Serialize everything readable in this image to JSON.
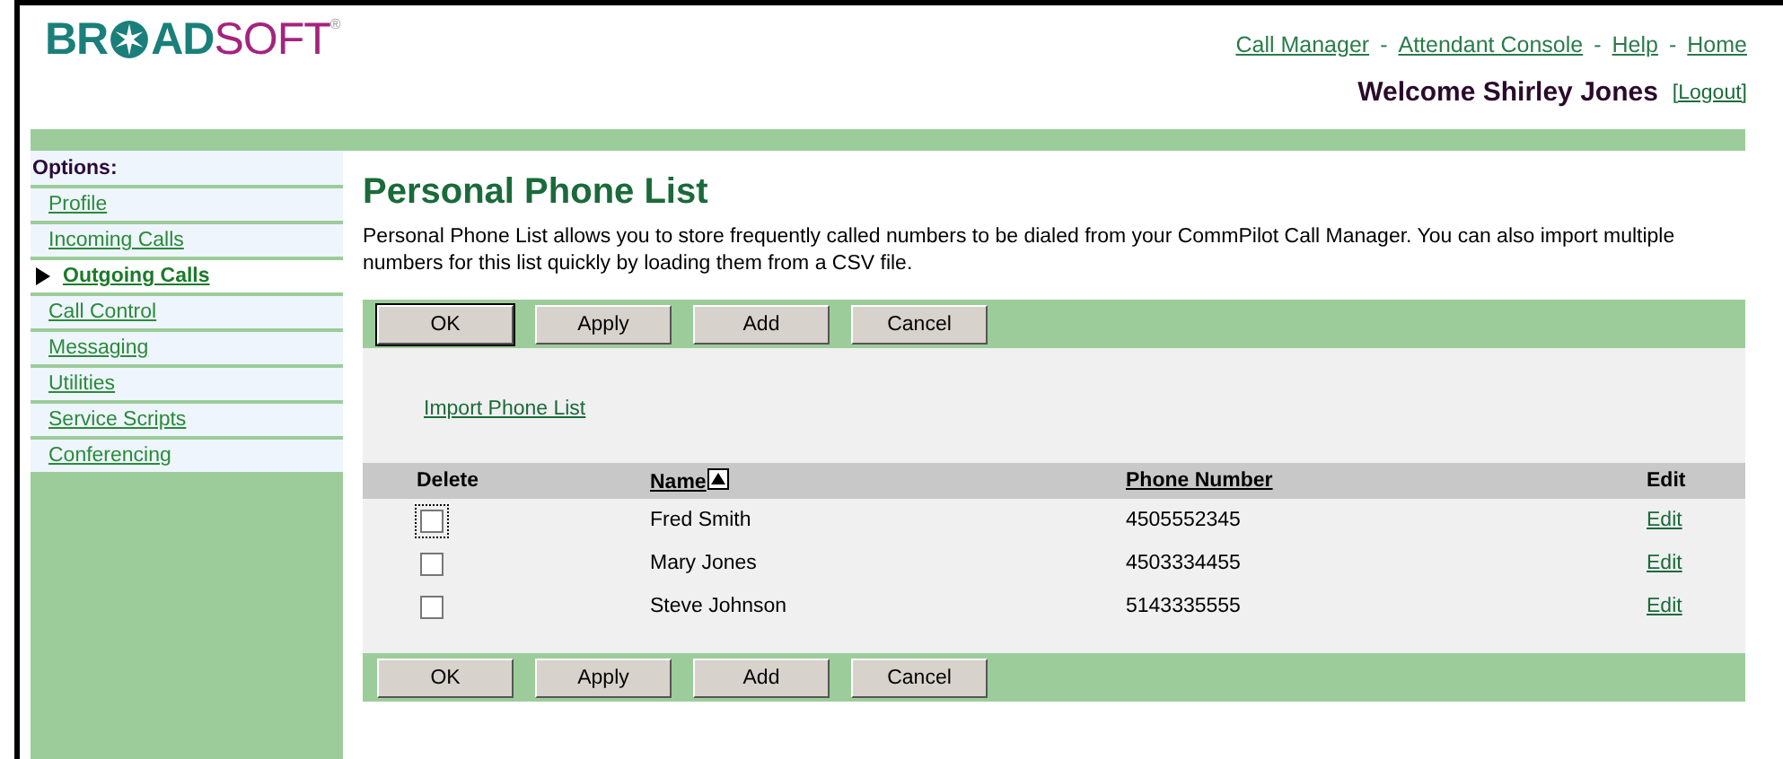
{
  "logo": {
    "part_1": "BR",
    "part_2": "AD",
    "part_3": "SOFT",
    "mark": "®"
  },
  "top_links": [
    "Call Manager",
    "Attendant Console",
    "Help",
    "Home"
  ],
  "link_separator": "-",
  "welcome": "Welcome Shirley Jones",
  "logout": "[Logout]",
  "sidebar": {
    "heading": "Options:",
    "items": [
      {
        "label": "Profile",
        "selected": false
      },
      {
        "label": "Incoming Calls",
        "selected": false
      },
      {
        "label": "Outgoing Calls",
        "selected": true
      },
      {
        "label": "Call Control",
        "selected": false
      },
      {
        "label": "Messaging",
        "selected": false
      },
      {
        "label": "Utilities",
        "selected": false
      },
      {
        "label": "Service Scripts",
        "selected": false
      },
      {
        "label": "Conferencing",
        "selected": false
      }
    ]
  },
  "page": {
    "title": "Personal Phone List",
    "description": "Personal Phone List allows you to store frequently called numbers to be dialed from your CommPilot Call Manager. You can also import multiple numbers for this list quickly by loading them from a CSV file.",
    "buttons_top": [
      "OK",
      "Apply",
      "Add",
      "Cancel"
    ],
    "import_link": "Import Phone List",
    "table": {
      "columns": [
        "Delete",
        "Name",
        "Phone Number",
        "Edit"
      ],
      "rows": [
        {
          "checked": false,
          "focused": true,
          "name": "Fred Smith",
          "phone": "4505552345",
          "edit": "Edit"
        },
        {
          "checked": false,
          "focused": false,
          "name": "Mary Jones",
          "phone": "4503334455",
          "edit": "Edit"
        },
        {
          "checked": false,
          "focused": false,
          "name": "Steve Johnson",
          "phone": "5143335555",
          "edit": "Edit"
        }
      ]
    },
    "buttons_bottom": [
      "OK",
      "Apply",
      "Add",
      "Cancel"
    ]
  }
}
